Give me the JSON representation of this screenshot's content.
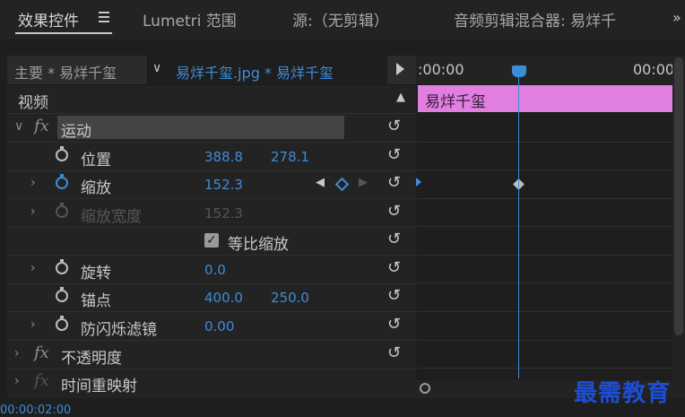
{
  "tabs": [
    {
      "label": "效果控件"
    },
    {
      "label": "Lumetri 范围"
    },
    {
      "label": "源:（无剪辑）"
    },
    {
      "label": "音频剪辑混合器: 易烊千"
    }
  ],
  "source_bar": {
    "master": "主要 * 易烊千玺",
    "clip": "易烊千玺.jpg * 易烊千玺"
  },
  "timeline": {
    "start": ":00:00",
    "end": "00:00",
    "clip_label": "易烊千玺"
  },
  "section": {
    "video": "视频"
  },
  "effects": {
    "motion": "运动",
    "position": {
      "label": "位置",
      "x": "388.8",
      "y": "278.1"
    },
    "scale": {
      "label": "缩放",
      "value": "152.3"
    },
    "scale_width": {
      "label": "缩放宽度",
      "value": "152.3"
    },
    "uniform": {
      "label": "等比缩放"
    },
    "rotation": {
      "label": "旋转",
      "value": "0.0"
    },
    "anchor": {
      "label": "锚点",
      "x": "400.0",
      "y": "250.0"
    },
    "flicker": {
      "label": "防闪烁滤镜",
      "value": "0.00"
    },
    "opacity": "不透明度",
    "time_remap": "时间重映射"
  },
  "timecode": "00:00:02:00",
  "watermark": "最需教育",
  "colors": {
    "accent": "#3d8cd8",
    "clip": "#e17fe0"
  }
}
